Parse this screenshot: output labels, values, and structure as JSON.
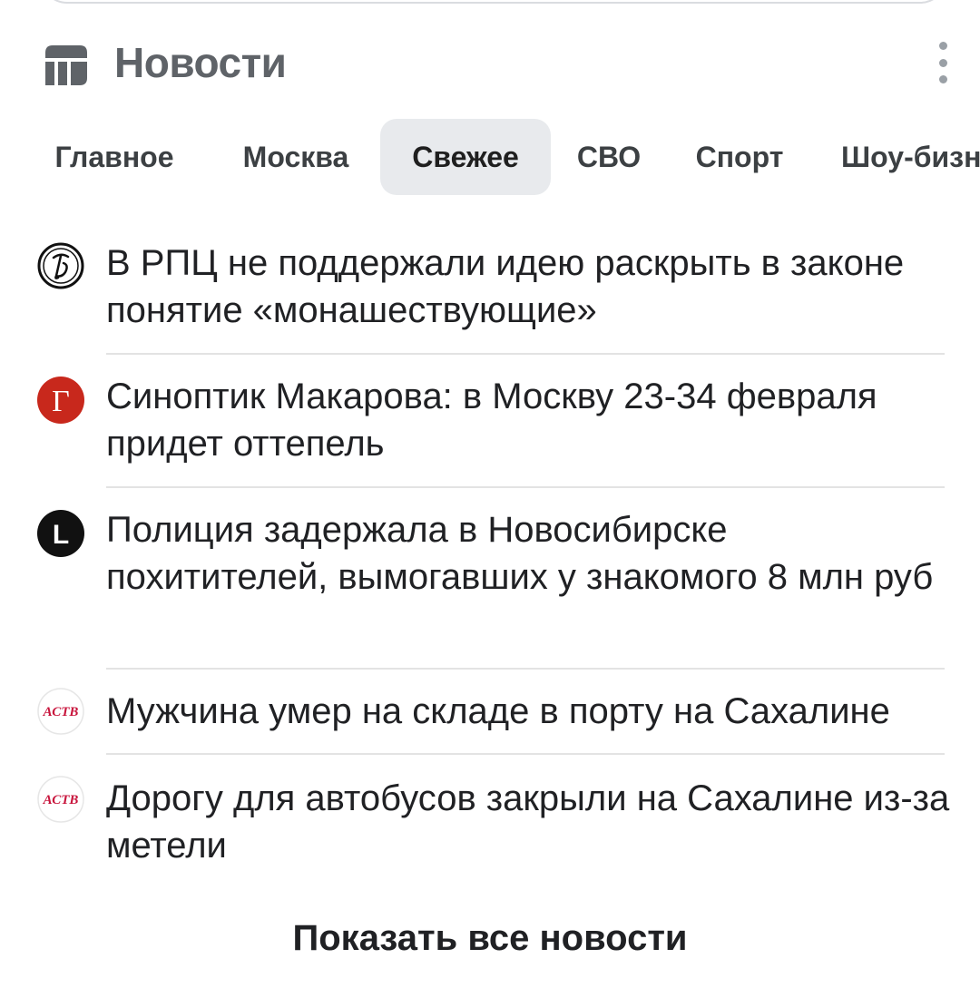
{
  "header": {
    "title": "Новости",
    "menu_icon": "more-vert-icon"
  },
  "tabs": [
    {
      "label": "Главное"
    },
    {
      "label": "Москва"
    },
    {
      "label": "Свежее",
      "active": true
    },
    {
      "label": "СВО"
    },
    {
      "label": "Спорт"
    },
    {
      "label": "Шоу-бизнес"
    }
  ],
  "news": [
    {
      "source_icon": "source-logo-icon",
      "title": "В РПЦ не поддержали идею раскрыть в законе понятие «монашествующие»"
    },
    {
      "source_icon": "source-logo-icon",
      "title": "Синоптик Макарова: в Москву 23-34 февраля придет оттепель"
    },
    {
      "source_icon": "source-logo-icon",
      "title": "Полиция задержала в Новосибирске похитителей, вымогавших у знакомого 8 млн руб"
    },
    {
      "source_icon": "source-logo-icon",
      "title": "Мужчина умер на складе в порту на Сахалине"
    },
    {
      "source_icon": "source-logo-icon",
      "title": "Дорогу для автобусов закрыли на Сахалине из-за метели"
    }
  ],
  "sources": {
    "gazeta_letter": "Г",
    "lenta_letter": "L",
    "astv_text": "АСТВ"
  },
  "footer": {
    "show_all_label": "Показать все новости"
  },
  "colors": {
    "accent_red": "#c8281c",
    "astv_red": "#c8143c"
  }
}
